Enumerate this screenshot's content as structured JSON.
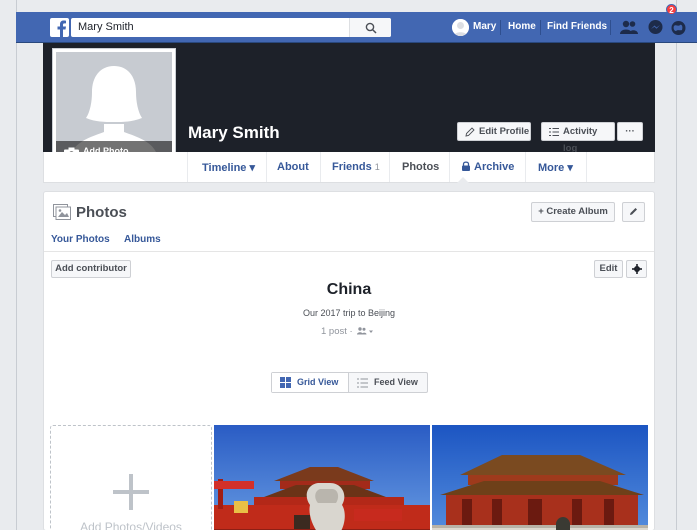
{
  "topbar": {
    "search_value": "Mary Smith",
    "user_name": "Mary",
    "home": "Home",
    "find_friends": "Find Friends",
    "notification_count": "2"
  },
  "profile": {
    "name": "Mary Smith",
    "add_photo": "Add Photo",
    "edit_profile": "Edit Profile",
    "activity_log": "Activity log",
    "more_dots": "···"
  },
  "tabs": [
    {
      "label": "Timeline ▾"
    },
    {
      "label": "About"
    },
    {
      "label": "Friends",
      "count": "1"
    },
    {
      "label": "Photos"
    },
    {
      "label": "Archive"
    },
    {
      "label": "More ▾"
    }
  ],
  "photos": {
    "title": "Photos",
    "create_album": "+ Create Album",
    "your_photos": "Your Photos",
    "albums": "Albums",
    "add_contributor": "Add contributor",
    "edit": "Edit",
    "album_title": "China",
    "album_description": "Our 2017 trip to Beijing",
    "album_meta": "1 post ·",
    "grid_view": "Grid View",
    "feed_view": "Feed View",
    "add_tile": "Add Photos/Videos"
  },
  "colors": {
    "brand_blue": "#4267b2",
    "link_blue": "#365899",
    "cover_dark": "#1d2129"
  }
}
